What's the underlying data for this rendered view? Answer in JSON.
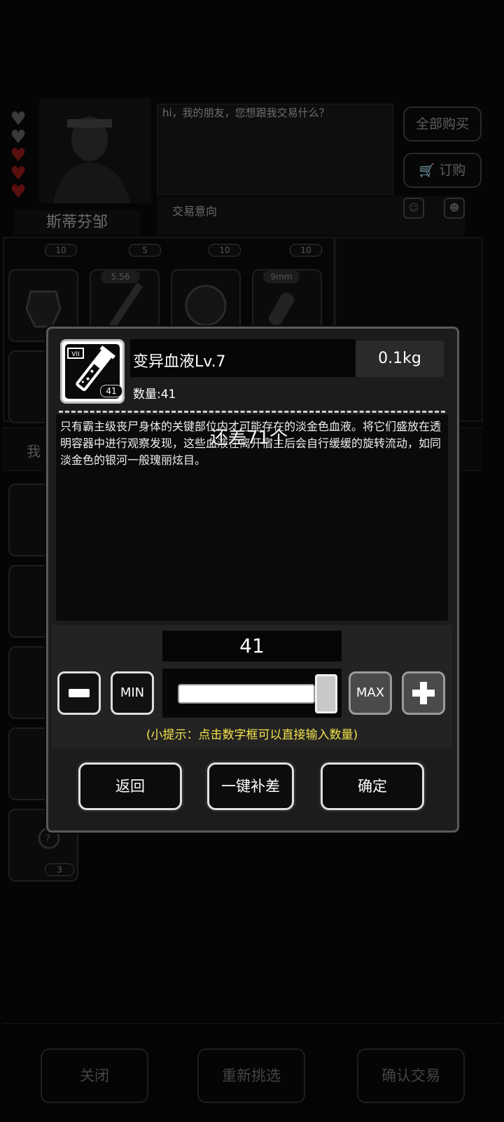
{
  "background": {
    "npc": {
      "name": "斯蒂芬邹",
      "hearts": {
        "filled": 3,
        "total": 5
      }
    },
    "dialog_text": "hi，我的朋友，您想跟我交易什么？",
    "intent_label": "交易意向",
    "buy_all_label": "全部购买",
    "order_label": "订购",
    "grid_badges": [
      "10",
      "5",
      "10",
      "10"
    ],
    "ammo_tags": [
      "5.56",
      "9mm"
    ],
    "mid_label": "我",
    "side_slot_badge": "3",
    "bottom_buttons": {
      "close": "关闭",
      "reselect": "重新挑选",
      "confirm_trade": "确认交易"
    }
  },
  "modal": {
    "item": {
      "name": "变异血液Lv.7",
      "weight": "0.1kg",
      "quantity_label": "数量:41",
      "icon_count": "41",
      "icon_level": "VII",
      "description": "只有霸主级丧尸身体的关键部位内才可能存在的淡金色血液。将它们盛放在透明容器中进行观察发现，这些血液在离开宿主后会自行缓缓的旋转流动，如同淡金色的银河一般瑰丽炫目。"
    },
    "overlay_message": "还差71个",
    "quantity_value": "41",
    "slider_level": 1.0,
    "min_label": "MIN",
    "max_label": "MAX",
    "hint": "(小提示：点击数字框可以直接输入数量)",
    "buttons": {
      "back": "返回",
      "fill_gap": "一键补差",
      "confirm": "确定"
    }
  },
  "colors": {
    "hint": "#f3e24a",
    "modal_border": "#5a5a5a",
    "button_border": "#e0e0e0"
  }
}
